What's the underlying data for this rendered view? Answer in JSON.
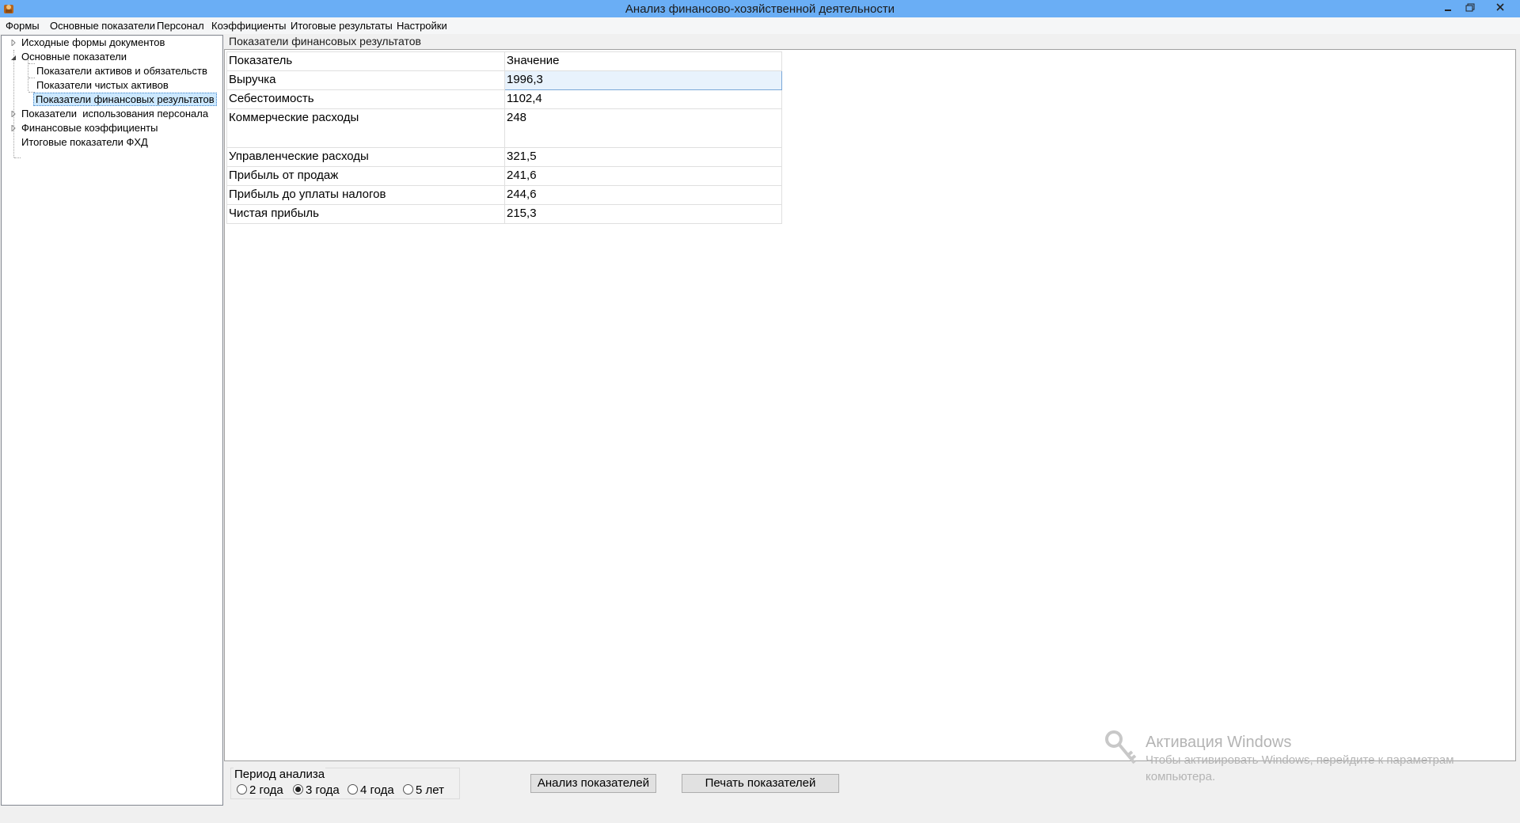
{
  "window": {
    "title": "Анализ финансово-хозяйственной деятельности",
    "title_bar_color": "#6aaef5"
  },
  "menu": {
    "items": [
      "Формы",
      "Основные показатели",
      "Персонал",
      "Коэффициенты",
      "Итоговые результаты",
      "Настройки"
    ]
  },
  "tree": {
    "items": [
      {
        "label": "Исходные формы документов",
        "expander": "collapsed"
      },
      {
        "label": "Основные показатели",
        "expander": "expanded"
      },
      {
        "label": "Показатели активов и обязательств"
      },
      {
        "label": "Показатели чистых активов"
      },
      {
        "label": "Показатели финансовых результатов",
        "selected": true
      },
      {
        "label": "Показатели  использования персонала",
        "expander": "collapsed"
      },
      {
        "label": "Финансовые коэффициенты",
        "expander": "collapsed"
      },
      {
        "label": "Итоговые показатели ФХД"
      }
    ]
  },
  "main": {
    "group_title": "Показатели финансовых результатов",
    "grid": {
      "headers": [
        "Показатель",
        "Значение"
      ],
      "rows": [
        {
          "name": "Выручка",
          "value": "1996,3",
          "current": true
        },
        {
          "name": "Себестоимость",
          "value": "1102,4"
        },
        {
          "name": "Коммерческие расходы",
          "value": "248",
          "tall": true
        },
        {
          "name": "Управленческие расходы",
          "value": "321,5"
        },
        {
          "name": "Прибыль от продаж",
          "value": "241,6"
        },
        {
          "name": "Прибыль до уплаты налогов",
          "value": "244,6"
        },
        {
          "name": "Чистая прибыль",
          "value": "215,3"
        }
      ]
    }
  },
  "period": {
    "label": "Период анализа",
    "options": [
      {
        "label": "2 года",
        "checked": false
      },
      {
        "label": "3 года",
        "checked": true
      },
      {
        "label": "4 года",
        "checked": false
      },
      {
        "label": "5 лет",
        "checked": false
      }
    ]
  },
  "buttons": {
    "analyze": "Анализ показателей",
    "print": "Печать показателей"
  },
  "watermark": {
    "title": "Активация Windows",
    "line1": "Чтобы активировать Windows, перейдите к параметрам",
    "line2": "компьютера."
  }
}
